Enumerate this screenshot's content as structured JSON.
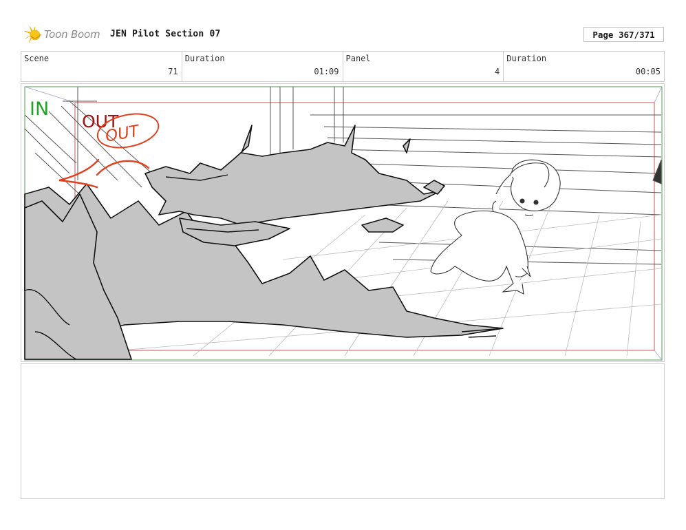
{
  "header": {
    "brand_name": "Toon Boom",
    "doc_title": "JEN Pilot Section 07",
    "page_label": "Page 367/371"
  },
  "info": {
    "scene_label": "Scene",
    "scene_value": "71",
    "scene_duration_label": "Duration",
    "scene_duration_value": "01:09",
    "panel_label": "Panel",
    "panel_value": "4",
    "panel_duration_label": "Duration",
    "panel_duration_value": "00:05"
  },
  "panel": {
    "in_marker": "IN",
    "out_marker": "OUT",
    "out_handwritten": "OUT",
    "in_color": "#22a22a",
    "out_color": "#a51212",
    "annotation_color": "#e2401c",
    "debris_fill": "#c4c4c4"
  },
  "notes": {
    "text": ""
  }
}
